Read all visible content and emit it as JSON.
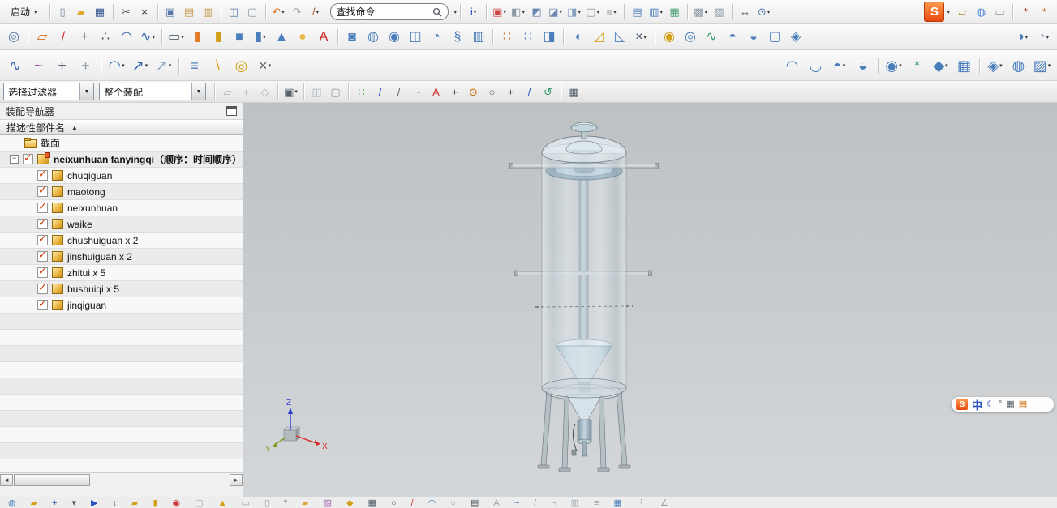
{
  "glyphs": {
    "caret": "▾",
    "check": "✓",
    "expander_minus": "−",
    "scroll_left": "◄",
    "scroll_right": "►"
  },
  "start_menu": {
    "label": "启动"
  },
  "search": {
    "placeholder": "查找命令"
  },
  "selection_bar": {
    "filter_label": "选择过滤器",
    "scope_value": "整个装配"
  },
  "assembly_navigator": {
    "title": "装配导航器",
    "column_header": "描述性部件名",
    "sort_indicator": "▲",
    "tree": [
      {
        "label": "截面",
        "icon": "folder",
        "indent": 30,
        "expander": false,
        "checkbox": false
      },
      {
        "label": "neixunhuan fanyingqi（顺序：时间顺序）",
        "icon": "assembly",
        "indent": 12,
        "expander": true,
        "checkbox": true,
        "checked": true,
        "bold": true
      },
      {
        "label": "chuqiguan",
        "icon": "part",
        "indent": 46,
        "checkbox": true,
        "checked": true
      },
      {
        "label": "maotong",
        "icon": "part",
        "indent": 46,
        "checkbox": true,
        "checked": true
      },
      {
        "label": "neixunhuan",
        "icon": "part",
        "indent": 46,
        "checkbox": true,
        "checked": true
      },
      {
        "label": "waike",
        "icon": "part",
        "indent": 46,
        "checkbox": true,
        "checked": true
      },
      {
        "label": "chushuiguan x 2",
        "icon": "part",
        "indent": 46,
        "checkbox": true,
        "checked": true
      },
      {
        "label": "jinshuiguan x 2",
        "icon": "part",
        "indent": 46,
        "checkbox": true,
        "checked": true
      },
      {
        "label": "zhitui x 5",
        "icon": "part",
        "indent": 46,
        "checkbox": true,
        "checked": true
      },
      {
        "label": "bushuiqi x 5",
        "icon": "part",
        "indent": 46,
        "checkbox": true,
        "checked": true
      },
      {
        "label": "jinqiguan",
        "icon": "part",
        "indent": 46,
        "checkbox": true,
        "checked": true
      }
    ],
    "filler_rows": 10
  },
  "viewport": {
    "axis_x": "X",
    "axis_y": "Y",
    "axis_z": "Z"
  },
  "ime_bar": {
    "logo": "S",
    "lang": "中"
  },
  "toolbars": {
    "row1a": [
      [
        {
          "n": "new-file-icon",
          "g": "▯",
          "c": "#7a8aa0"
        },
        {
          "n": "open-folder-icon",
          "g": "▰",
          "c": "#e0a830"
        },
        {
          "n": "save-icon",
          "g": "▦",
          "c": "#33518f"
        }
      ],
      [
        {
          "n": "cut-scissors-icon",
          "g": "✂",
          "c": "#444444"
        },
        {
          "n": "delete-icon",
          "g": "×",
          "c": "#222222"
        }
      ],
      [
        {
          "n": "copy-icon",
          "g": "▣",
          "c": "#5577aa"
        },
        {
          "n": "paste-icon",
          "g": "▤",
          "c": "#c79a4a"
        },
        {
          "n": "paste-special-icon",
          "g": "▥",
          "c": "#c79a4a"
        }
      ],
      [
        {
          "n": "copy-display-icon",
          "g": "◫",
          "c": "#5577aa"
        },
        {
          "n": "export-image-icon",
          "g": "▢",
          "c": "#8a98a2"
        }
      ],
      [
        {
          "n": "undo-icon",
          "g": "↶",
          "c": "#e07b2a",
          "v": 1
        },
        {
          "n": "redo-icon",
          "g": "↷",
          "c": "#9a9aa0"
        },
        {
          "n": "format-painter-icon",
          "g": "/",
          "c": "#b05030",
          "v": 1
        }
      ]
    ],
    "row1b": [
      [
        {
          "n": "info-icon",
          "g": "i",
          "c": "#2a52be",
          "v": 1
        }
      ],
      [
        {
          "n": "screen-layout-icon",
          "g": "▣",
          "c": "#cc4444",
          "v": 1
        },
        {
          "n": "view-orient-icon",
          "g": "◧",
          "c": "#8a98a2",
          "v": 1
        },
        {
          "n": "view-top-icon",
          "g": "◩",
          "c": "#6a88b0"
        },
        {
          "n": "view-iso-icon",
          "g": "◪",
          "c": "#6a88b0",
          "v": 1
        },
        {
          "n": "render-style-icon",
          "g": "◨",
          "c": "#88a0c0",
          "v": 1
        },
        {
          "n": "window-icon",
          "g": "▢",
          "c": "#8a98a2",
          "v": 1
        },
        {
          "n": "background-icon",
          "g": "■",
          "c": "#c2c8cc",
          "v": 1
        }
      ],
      [
        {
          "n": "assembly-table-icon",
          "g": "▤",
          "c": "#4a7ebb"
        },
        {
          "n": "part-family-icon",
          "g": "▥",
          "c": "#4a7ebb",
          "v": 1
        },
        {
          "n": "expression-table-icon",
          "g": "▦",
          "c": "#3a9a6a"
        }
      ],
      [
        {
          "n": "layer-settings-icon",
          "g": "▩",
          "c": "#8a98a2",
          "v": 1
        },
        {
          "n": "visible-layers-icon",
          "g": "▨",
          "c": "#8a98a2"
        }
      ],
      [
        {
          "n": "move-component-icon",
          "g": "↔",
          "c": "#445566"
        },
        {
          "n": "assembly-constraint-icon",
          "g": "⊙",
          "c": "#5577aa",
          "v": 1
        }
      ]
    ],
    "row1c": [
      [
        {
          "n": "edit-object-icon",
          "g": "▱",
          "c": "#b09040"
        },
        {
          "n": "web-browser-icon",
          "g": "◍",
          "c": "#3a7ad4"
        },
        {
          "n": "help-doc-icon",
          "g": "▭",
          "c": "#8a98a2"
        }
      ],
      [
        {
          "n": "datum-star-icon",
          "g": "*",
          "c": "#bb3333"
        },
        {
          "n": "datum-star-small-icon",
          "g": "*",
          "c": "#cc7733"
        }
      ]
    ],
    "row2": [
      [
        {
          "n": "sketch-icon",
          "g": "◎",
          "c": "#5577aa"
        }
      ],
      [
        {
          "n": "datum-plane-icon",
          "g": "▱",
          "c": "#d07020"
        },
        {
          "n": "datum-axis-icon",
          "g": "/",
          "c": "#cc3333"
        },
        {
          "n": "point-icon",
          "g": "+",
          "c": "#445566"
        },
        {
          "n": "point-set-icon",
          "g": "∴",
          "c": "#445566"
        },
        {
          "n": "arc-icon",
          "g": "◠",
          "c": "#3a66b0"
        },
        {
          "n": "spline-icon",
          "g": "∿",
          "c": "#3a66b0",
          "v": 1
        }
      ],
      [
        {
          "n": "extrude-icon",
          "g": "▭",
          "c": "#55606a",
          "v": 1
        },
        {
          "n": "revolve-icon",
          "g": "▮",
          "c": "#e07b2a"
        },
        {
          "n": "hole-icon",
          "g": "▮",
          "c": "#d4a017"
        },
        {
          "n": "block-icon",
          "g": "■",
          "c": "#4a7ebb"
        },
        {
          "n": "cylinder-icon",
          "g": "▮",
          "c": "#4a7ebb",
          "v": 1
        },
        {
          "n": "cone-icon",
          "g": "▲",
          "c": "#4a7ebb"
        },
        {
          "n": "sphere-icon",
          "g": "●",
          "c": "#e8b84b"
        },
        {
          "n": "text-icon",
          "g": "A",
          "c": "#cc2222"
        }
      ],
      [
        {
          "n": "unite-icon",
          "g": "◙",
          "c": "#4a7ebb"
        },
        {
          "n": "subtract-icon",
          "g": "◍",
          "c": "#4a7ebb"
        },
        {
          "n": "intersect-icon",
          "g": "◉",
          "c": "#4a7ebb"
        },
        {
          "n": "sew-icon",
          "g": "◫",
          "c": "#4a7ebb"
        },
        {
          "n": "shell-icon",
          "g": "◔",
          "c": "#4a7ebb"
        },
        {
          "n": "thread-icon",
          "g": "§",
          "c": "#4a7ebb"
        },
        {
          "n": "rib-icon",
          "g": "▥",
          "c": "#4a7ebb"
        }
      ],
      [
        {
          "n": "pattern-feature-icon",
          "g": "∷",
          "c": "#d07020"
        },
        {
          "n": "pattern-face-icon",
          "g": "∷",
          "c": "#4a7ebb"
        },
        {
          "n": "mirror-feature-icon",
          "g": "◨",
          "c": "#4a7ebb"
        }
      ],
      [
        {
          "n": "edge-blend-icon",
          "g": "◖",
          "c": "#4a7ebb"
        },
        {
          "n": "chamfer-icon",
          "g": "◿",
          "c": "#d4a017"
        },
        {
          "n": "draft-icon",
          "g": "◺",
          "c": "#4a7ebb"
        },
        {
          "n": "trim-body-icon",
          "g": "×",
          "c": "#445566",
          "v": 1
        }
      ],
      [
        {
          "n": "coil-icon",
          "g": "◉",
          "c": "#d4a017"
        },
        {
          "n": "tube-icon",
          "g": "◎",
          "c": "#4a7ebb"
        },
        {
          "n": "sweep-icon",
          "g": "∿",
          "c": "#3a9a6a"
        },
        {
          "n": "ruled-surface-icon",
          "g": "◓",
          "c": "#4a7ebb"
        },
        {
          "n": "through-curves-icon",
          "g": "◒",
          "c": "#4a7ebb"
        },
        {
          "n": "bounded-plane-icon",
          "g": "▢",
          "c": "#4a7ebb"
        },
        {
          "n": "four-point-surface-icon",
          "g": "◈",
          "c": "#4a7ebb"
        }
      ]
    ],
    "row2_right": [
      [
        {
          "n": "shaded-view-icon",
          "g": "◑",
          "c": "#4a7ebb",
          "v": 1
        },
        {
          "n": "wireframe-view-icon",
          "g": "◔",
          "c": "#8aa4c0",
          "v": 1
        }
      ]
    ],
    "row3_left": [
      [
        {
          "n": "profile-curve-icon",
          "g": "∿",
          "c": "#3a66b0"
        },
        {
          "n": "studio-spline-icon",
          "g": "~",
          "c": "#aa44aa"
        },
        {
          "n": "point-tool-icon",
          "g": "+",
          "c": "#445566"
        },
        {
          "n": "point-cloud-icon",
          "g": "+",
          "c": "#8a98a2"
        }
      ],
      [
        {
          "n": "bridge-curve-icon",
          "g": "◠",
          "c": "#3a66b0",
          "v": 1
        },
        {
          "n": "project-curve-icon",
          "g": "↗",
          "c": "#3a66b0",
          "v": 1
        },
        {
          "n": "combine-curve-icon",
          "g": "↗",
          "c": "#8aa4c0",
          "v": 1
        }
      ],
      [
        {
          "n": "curve-stack-icon",
          "g": "≡",
          "c": "#4a7ebb"
        },
        {
          "n": "stylus-icon",
          "g": "\\",
          "c": "#d4a017"
        },
        {
          "n": "donut-icon",
          "g": "◎",
          "c": "#d4a017"
        },
        {
          "n": "delete-curve-icon",
          "g": "×",
          "c": "#55606a",
          "v": 1
        }
      ]
    ],
    "row3_right": [
      [
        {
          "n": "swept-surface-icon",
          "g": "◠",
          "c": "#4a7ebb"
        },
        {
          "n": "styled-sweep-icon",
          "g": "◡",
          "c": "#4a7ebb"
        },
        {
          "n": "offset-surface-icon",
          "g": "◓",
          "c": "#4a7ebb",
          "v": 1
        },
        {
          "n": "trimmed-sheet-icon",
          "g": "◒",
          "c": "#4a7ebb"
        }
      ],
      [
        {
          "n": "fill-surface-icon",
          "g": "◉",
          "c": "#4a7ebb",
          "v": 1
        },
        {
          "n": "freeform-surface-icon",
          "g": "*",
          "c": "#3a9a6a"
        },
        {
          "n": "x-form-icon",
          "g": "◆",
          "c": "#4a7ebb",
          "v": 1
        },
        {
          "n": "i-form-icon",
          "g": "▦",
          "c": "#4a7ebb"
        }
      ],
      [
        {
          "n": "edge-surface-icon",
          "g": "◈",
          "c": "#4a7ebb",
          "v": 1
        },
        {
          "n": "law-extension-icon",
          "g": "◍",
          "c": "#4a7ebb"
        },
        {
          "n": "extension-surface-icon",
          "g": "▨",
          "c": "#4a7ebb",
          "v": 1
        }
      ]
    ],
    "selection": [
      [
        {
          "n": "highlight-icon",
          "g": "▱",
          "c": "#aab4bc"
        },
        {
          "n": "select-all-icon",
          "g": "+",
          "c": "#aab4bc"
        },
        {
          "n": "deselect-icon",
          "g": "◇",
          "c": "#aab4bc"
        }
      ],
      [
        {
          "n": "rectangle-select-icon",
          "g": "▣",
          "c": "#55606a",
          "v": 1
        }
      ],
      [
        {
          "n": "shaded-select-icon",
          "g": "◫",
          "c": "#aab4bc"
        },
        {
          "n": "face-filter-icon",
          "g": "▢",
          "c": "#8a98a2"
        }
      ],
      [
        {
          "n": "snap-point-icon",
          "g": "∷",
          "c": "#3a9a3a"
        },
        {
          "n": "snap-endpoint-icon",
          "g": "/",
          "c": "#2a52be"
        },
        {
          "n": "snap-midpoint-icon",
          "g": "/",
          "c": "#55606a"
        },
        {
          "n": "snap-curve-icon",
          "g": "~",
          "c": "#2a52be"
        },
        {
          "n": "snap-text-icon",
          "g": "A",
          "c": "#cc3333"
        },
        {
          "n": "snap-intersection-icon",
          "g": "+",
          "c": "#55606a"
        },
        {
          "n": "snap-center-icon",
          "g": "⊙",
          "c": "#cc6600"
        },
        {
          "n": "snap-circle-icon",
          "g": "○",
          "c": "#55606a"
        },
        {
          "n": "snap-quadrant-icon",
          "g": "+",
          "c": "#55606a"
        },
        {
          "n": "snap-tangent-icon",
          "g": "/",
          "c": "#2a52be"
        },
        {
          "n": "snap-rotate-icon",
          "g": "↺",
          "c": "#3a9a6a"
        }
      ],
      [
        {
          "n": "grid-table-icon",
          "g": "▦",
          "c": "#55606a"
        }
      ]
    ],
    "bottom": [
      {
        "n": "touch-mode-icon",
        "g": "◍",
        "c": "#4a7ebb"
      },
      {
        "n": "open-recent-icon",
        "g": "▰",
        "c": "#d4a017"
      },
      {
        "n": "add-component-icon",
        "g": "+",
        "c": "#2a52be"
      },
      {
        "n": "dropdown-icon",
        "g": "▾",
        "c": "#55606a"
      },
      {
        "n": "flag-icon",
        "g": "▶",
        "c": "#2a52be"
      },
      {
        "n": "download-icon",
        "g": "↓",
        "c": "#55606a"
      },
      {
        "n": "folder-icon",
        "g": "▰",
        "c": "#d4a017"
      },
      {
        "n": "brick-icon",
        "g": "▮",
        "c": "#d4a017"
      },
      {
        "n": "pin-icon",
        "g": "◉",
        "c": "#cc3333"
      },
      {
        "n": "blank-page-icon",
        "g": "▢",
        "c": "#9aa4ac"
      },
      {
        "n": "warning-icon",
        "g": "▲",
        "c": "#d4a017"
      },
      {
        "n": "note-icon",
        "g": "▭",
        "c": "#9aa4ac"
      },
      {
        "n": "page-icon",
        "g": "▯",
        "c": "#9aa4ac"
      },
      {
        "n": "gear-icon",
        "g": "*",
        "c": "#55606a"
      },
      {
        "n": "folder-open-icon",
        "g": "▰",
        "c": "#e0a830"
      },
      {
        "n": "texture-icon",
        "g": "▨",
        "c": "#a06ab0"
      },
      {
        "n": "gem-icon",
        "g": "◆",
        "c": "#d4a017"
      },
      {
        "n": "keyboard-icon",
        "g": "▦",
        "c": "#55606a"
      },
      {
        "n": "circle-tool-icon",
        "g": "○",
        "c": "#55606a"
      },
      {
        "n": "pen-tool-icon",
        "g": "/",
        "c": "#cc3333"
      },
      {
        "n": "arc-tool-icon",
        "g": "◠",
        "c": "#4a7ebb"
      },
      {
        "n": "ellipse-tool-icon",
        "g": "○",
        "c": "#8a98a2"
      },
      {
        "n": "sheet-icon",
        "g": "▤",
        "c": "#55606a"
      },
      {
        "n": "letter-icon",
        "g": "A",
        "c": "#9aa4ac"
      },
      {
        "n": "curve-icon",
        "g": "~",
        "c": "#2a52be"
      },
      {
        "n": "slash-icon",
        "g": "/",
        "c": "#9aa4ac"
      },
      {
        "n": "corner-icon",
        "g": "¬",
        "c": "#9aa4ac"
      },
      {
        "n": "rows-icon",
        "g": "▥",
        "c": "#9aa4ac"
      },
      {
        "n": "equal-icon",
        "g": "≡",
        "c": "#9aa4ac"
      },
      {
        "n": "grid-icon",
        "g": "▦",
        "c": "#4a7ebb"
      },
      {
        "n": "divider-icon",
        "g": "⋮",
        "c": "#9aa4ac"
      },
      {
        "n": "angle-icon",
        "g": "∠",
        "c": "#9aa4ac"
      }
    ]
  }
}
